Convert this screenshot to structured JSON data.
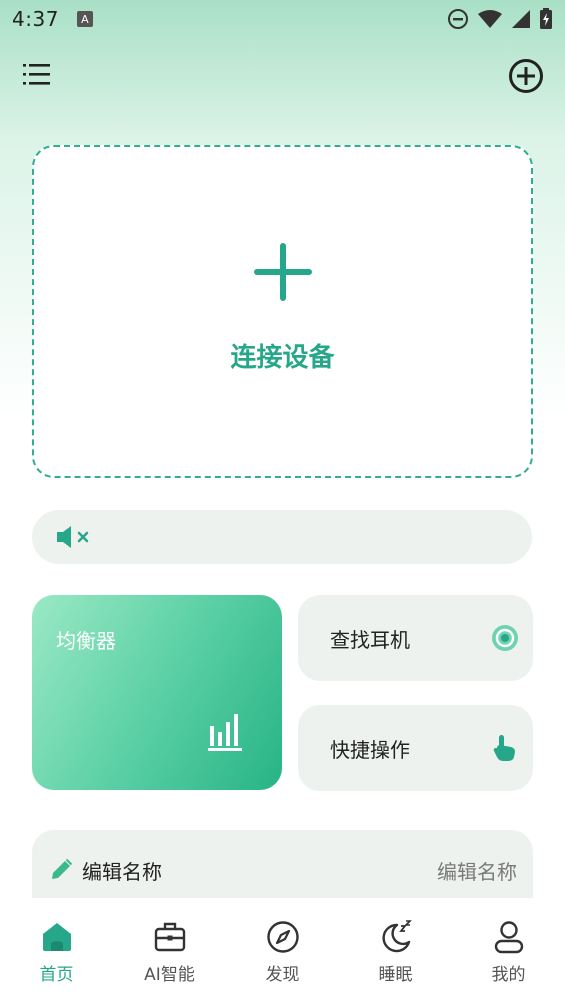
{
  "status_bar": {
    "time": "4:37",
    "a_badge": "A",
    "icons": [
      "do-not-disturb-icon",
      "wifi-icon",
      "signal-icon",
      "battery-charging-icon"
    ]
  },
  "header": {
    "menu_icon": "menu-icon",
    "add_icon": "add-circle-icon"
  },
  "connect": {
    "label": "连接设备",
    "icon": "plus-icon"
  },
  "volume": {
    "icon": "volume-muted-icon"
  },
  "equalizer": {
    "title": "均衡器",
    "icon": "bar-chart-icon"
  },
  "find_earphone": {
    "label": "查找耳机",
    "icon": "locate-icon"
  },
  "quick_actions": {
    "label": "快捷操作",
    "icon": "tap-hand-icon"
  },
  "rename": {
    "title": "编辑名称",
    "value": "编辑名称",
    "icon": "pencil-icon"
  },
  "bottom_nav": {
    "active_index": 0,
    "items": [
      {
        "label": "首页",
        "icon": "home-icon"
      },
      {
        "label": "AI智能",
        "icon": "briefcase-icon"
      },
      {
        "label": "发现",
        "icon": "compass-icon"
      },
      {
        "label": "睡眠",
        "icon": "moon-sleep-icon"
      },
      {
        "label": "我的",
        "icon": "user-icon"
      }
    ]
  },
  "colors": {
    "accent": "#27a78a",
    "card_bg": "#eef2ef",
    "gradient_top": "#a9e0c6"
  }
}
